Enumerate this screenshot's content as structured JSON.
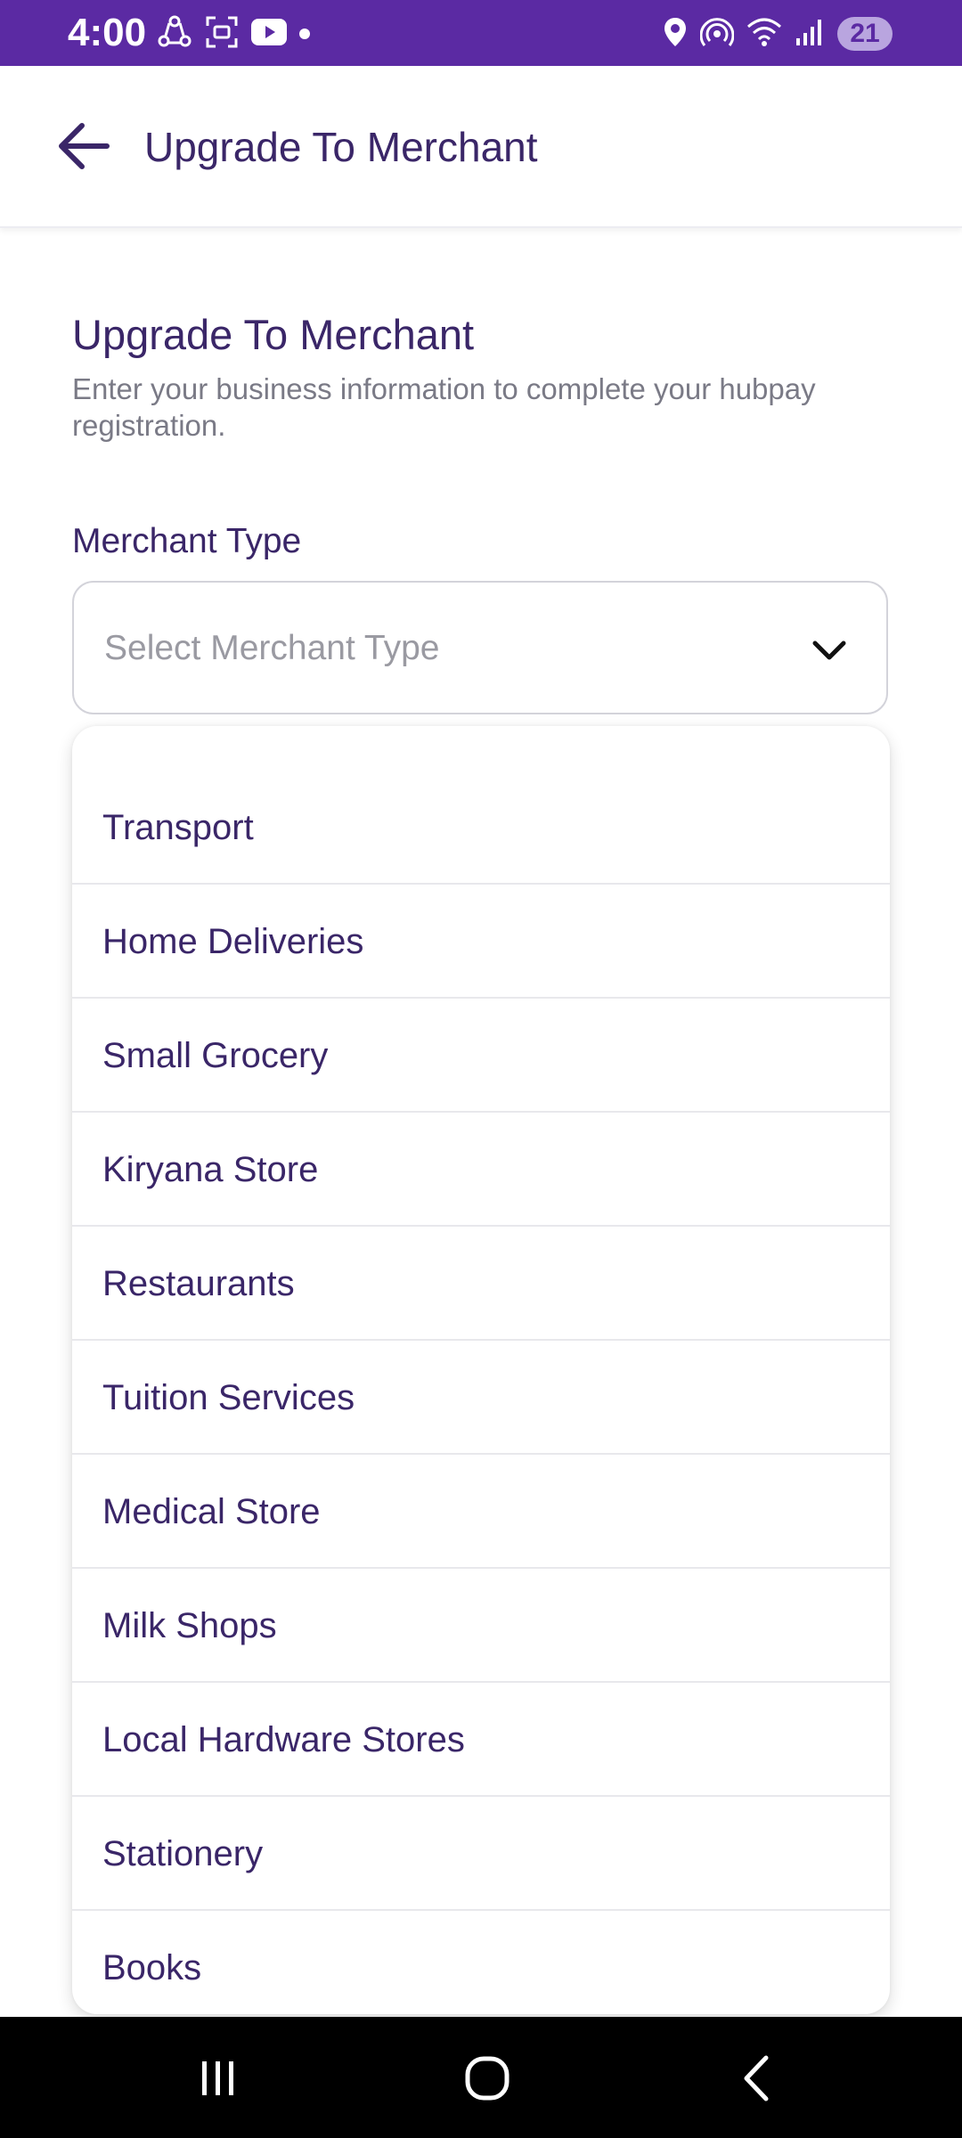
{
  "status_bar": {
    "time": "4:00",
    "battery_level": "21",
    "left_icons": [
      "sync-icon",
      "screenshot-icon",
      "youtube-icon",
      "notification-dot-icon"
    ],
    "right_icons": [
      "location-icon",
      "hotspot-icon",
      "wifi-icon",
      "signal-icon"
    ],
    "background_color": "#5b2aa3"
  },
  "app_bar": {
    "back_icon": "arrow-left-icon",
    "title": "Upgrade To Merchant"
  },
  "form": {
    "title": "Upgrade To Merchant",
    "subtitle": "Enter your business information to complete your hubpay registration.",
    "merchant_type": {
      "label": "Merchant Type",
      "placeholder": "Select Merchant Type",
      "chevron_icon": "chevron-down-icon",
      "options": [
        "Transport",
        "Home Deliveries",
        "Small Grocery",
        "Kiryana Store",
        "Restaurants",
        "Tuition Services",
        "Medical Store",
        "Milk Shops",
        "Local Hardware Stores",
        "Stationery",
        "Books"
      ]
    }
  },
  "nav_bar": {
    "recents_icon": "recents-icon",
    "home_icon": "home-icon",
    "back_icon": "back-chevron-icon"
  },
  "colors": {
    "accent": "#5b2aa3",
    "text_primary": "#3a2668",
    "text_secondary": "#7a7a86",
    "placeholder": "#9a9aa2"
  }
}
